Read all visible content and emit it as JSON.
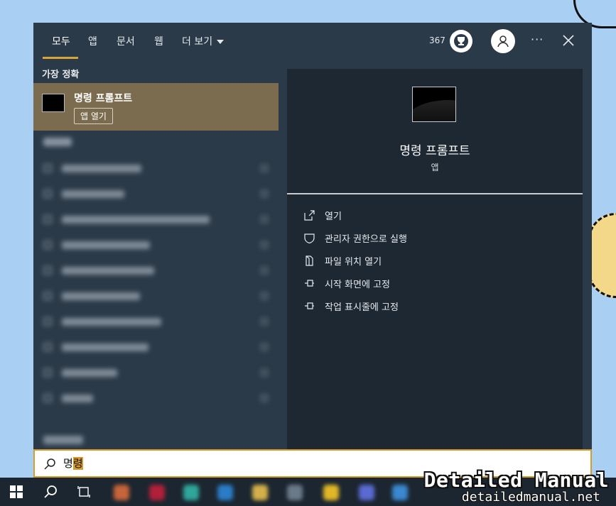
{
  "tabs": [
    {
      "label": "모두",
      "active": true
    },
    {
      "label": "앱"
    },
    {
      "label": "문서"
    },
    {
      "label": "웹"
    },
    {
      "label": "더 보기"
    }
  ],
  "header": {
    "points": "367",
    "trophy_icon": "trophy-icon",
    "avatar_icon": "user-icon",
    "more_label": "···",
    "close_icon": "close-icon"
  },
  "best_match": {
    "section_label": "가장 정확",
    "title": "명령 프롬프트",
    "open_button": "앱 열기",
    "highlight_color": "#7b6b4f"
  },
  "preview": {
    "title": "명령 프롬프트",
    "subtitle": "앱",
    "actions": [
      {
        "label": "열기",
        "icon": "open-external-icon"
      },
      {
        "label": "관리자 권한으로 실행",
        "icon": "shield-icon"
      },
      {
        "label": "파일 위치 열기",
        "icon": "file-location-icon"
      },
      {
        "label": "시작 화면에 고정",
        "icon": "pin-icon"
      },
      {
        "label": "작업 표시줄에 고정",
        "icon": "pin-icon"
      }
    ]
  },
  "search": {
    "typed": "명",
    "completion": "령",
    "accent_color": "#d69b2c"
  },
  "watermark": {
    "title": "Detailed Manual",
    "url": "detailedmanual.net"
  }
}
